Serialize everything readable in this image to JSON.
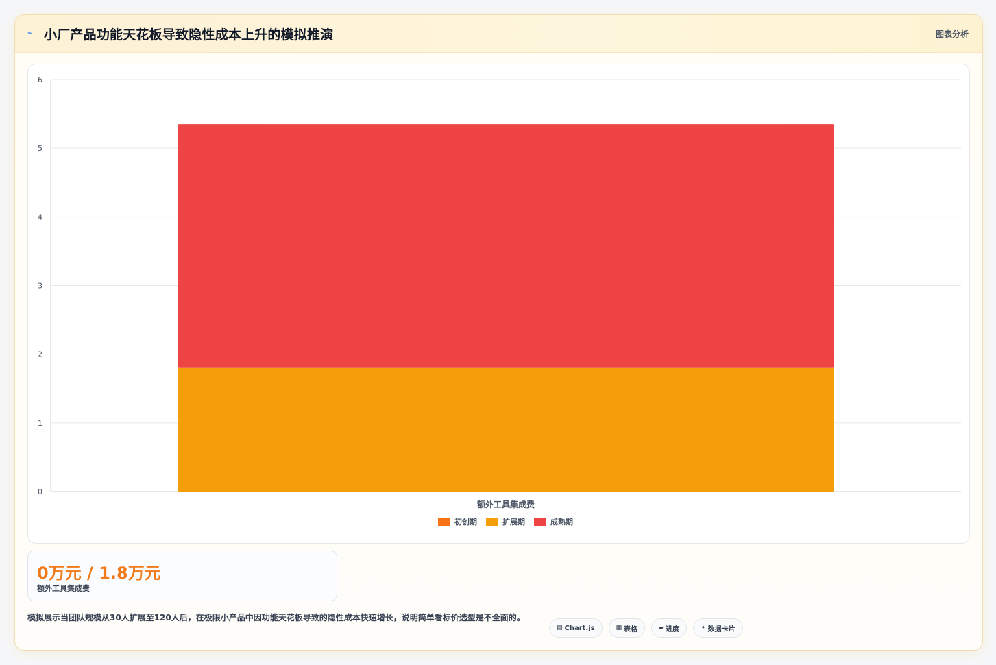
{
  "header": {
    "title": "小厂产品功能天花板导致隐性成本上升的模拟推演",
    "icon": "chart-line-icon",
    "right_label": "图表分析"
  },
  "chart_data": {
    "type": "bar",
    "stacked": true,
    "categories": [
      "额外工具集成费"
    ],
    "xlabel": "额外工具集成费",
    "ylabel": "",
    "ylim": [
      0,
      6
    ],
    "yticks": [
      0,
      1,
      2,
      3,
      4,
      5,
      6
    ],
    "grid": true,
    "legend_position": "bottom",
    "series": [
      {
        "name": "初创期",
        "values": [
          0
        ],
        "color": "#f97316"
      },
      {
        "name": "扩展期",
        "values": [
          1.8
        ],
        "color": "#f59e0b"
      },
      {
        "name": "成熟期",
        "values": [
          3.55
        ],
        "color": "#ef4444"
      }
    ]
  },
  "stat": {
    "value": "0万元 / 1.8万元",
    "label": "额外工具集成费"
  },
  "description": "模拟展示当团队规模从30人扩展至120人后，在极限小产品中因功能天花板导致的隐性成本快速增长，说明简单看标价选型是不全面的。",
  "tags": [
    {
      "icon": "chart-icon",
      "glyph": "▤",
      "label": "Chart.js"
    },
    {
      "icon": "table-icon",
      "glyph": "▦",
      "label": "表格"
    },
    {
      "icon": "progress-icon",
      "glyph": "▰",
      "label": "进度"
    },
    {
      "icon": "sparkle-icon",
      "glyph": "✦",
      "label": "数据卡片"
    }
  ]
}
